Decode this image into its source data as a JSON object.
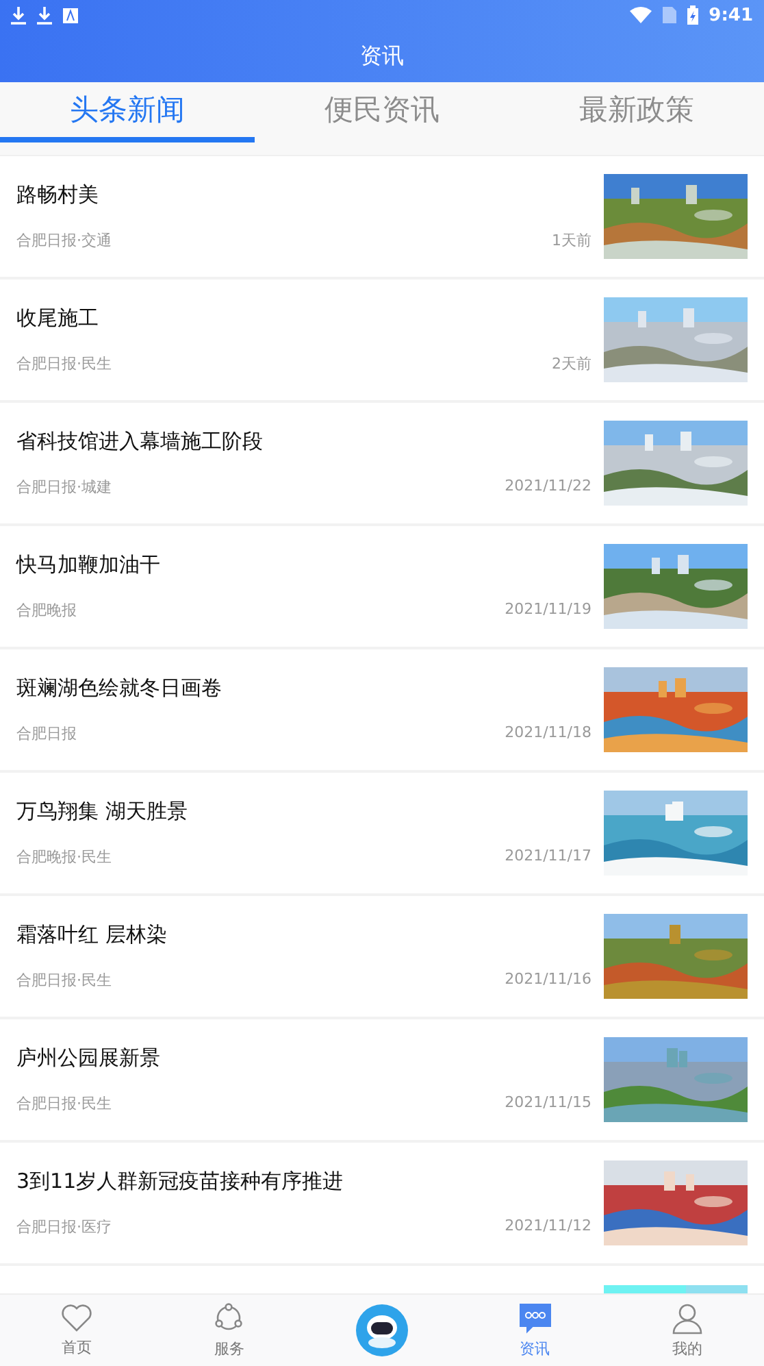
{
  "status_bar": {
    "time": "9:41"
  },
  "header": {
    "title": "资讯"
  },
  "tabs": [
    {
      "label": "头条新闻",
      "selected": true
    },
    {
      "label": "便民资讯",
      "selected": false
    },
    {
      "label": "最新政策",
      "selected": false
    }
  ],
  "news": [
    {
      "title": "路畅村美",
      "source": "合肥日报·交通",
      "time": "1天前"
    },
    {
      "title": "收尾施工",
      "source": "合肥日报·民生",
      "time": "2天前"
    },
    {
      "title": "省科技馆进入幕墙施工阶段",
      "source": "合肥日报·城建",
      "time": "2021/11/22"
    },
    {
      "title": "快马加鞭加油干",
      "source": "合肥晚报",
      "time": "2021/11/19"
    },
    {
      "title": "斑斓湖色绘就冬日画卷",
      "source": "合肥日报",
      "time": "2021/11/18"
    },
    {
      "title": "万鸟翔集 湖天胜景",
      "source": "合肥晚报·民生",
      "time": "2021/11/17"
    },
    {
      "title": "霜落叶红 层林染",
      "source": "合肥日报·民生",
      "time": "2021/11/16"
    },
    {
      "title": "庐州公园展新景",
      "source": "合肥日报·民生",
      "time": "2021/11/15"
    },
    {
      "title": "3到11岁人群新冠疫苗接种有序推进",
      "source": "合肥日报·医疗",
      "time": "2021/11/12"
    }
  ],
  "bottom_nav": [
    {
      "kind": "heart",
      "label": "首页",
      "selected": false
    },
    {
      "kind": "share",
      "label": "服务",
      "selected": false
    },
    {
      "kind": "robot",
      "selected": false
    },
    {
      "kind": "chat",
      "label": "资讯",
      "selected": true
    },
    {
      "kind": "person",
      "label": "我的",
      "selected": false
    }
  ]
}
